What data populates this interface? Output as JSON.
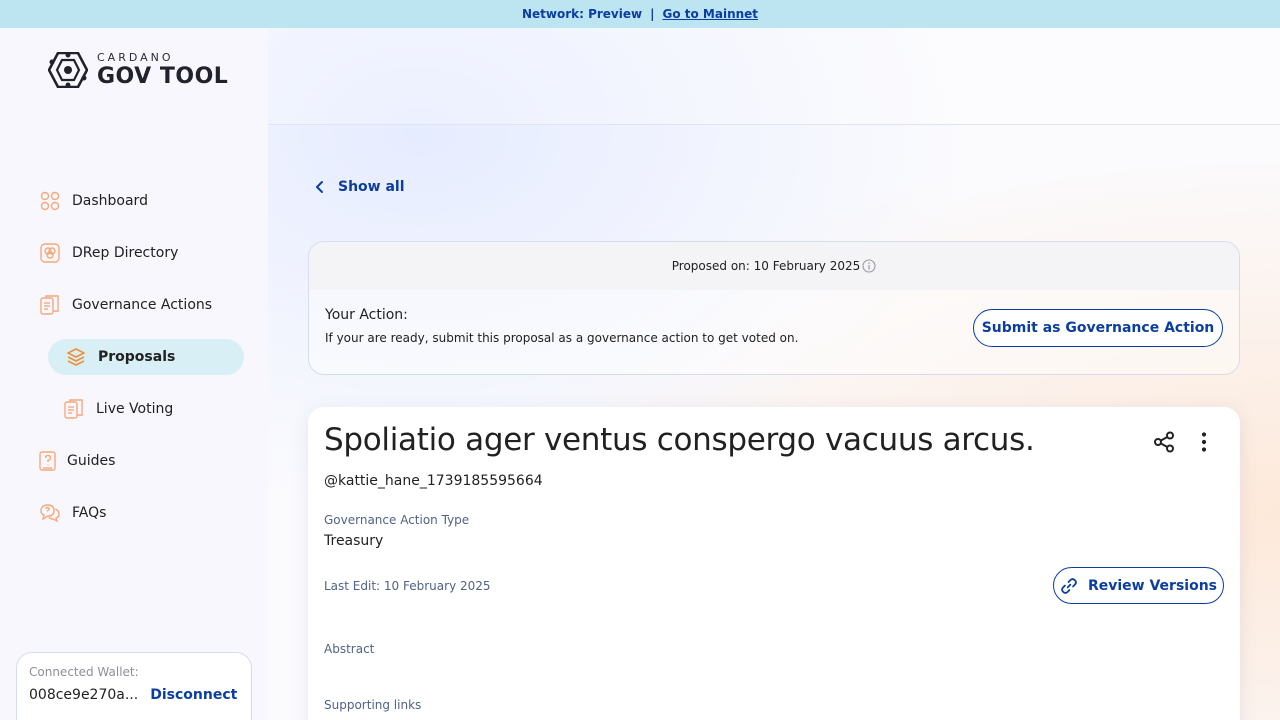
{
  "network_banner": {
    "label": "Network: Preview",
    "separator": "|",
    "link": "Go to Mainnet"
  },
  "logo": {
    "small_text": "CARDANO",
    "big_text": "GOV TOOL"
  },
  "sidebar": {
    "items": [
      {
        "label": "Dashboard",
        "icon": "dashboard-icon"
      },
      {
        "label": "DRep Directory",
        "icon": "drep-directory-icon"
      },
      {
        "label": "Governance Actions",
        "icon": "governance-actions-icon"
      },
      {
        "label": "Proposals",
        "icon": "proposals-icon",
        "active": true
      },
      {
        "label": "Live Voting",
        "icon": "live-voting-icon"
      },
      {
        "label": "Guides",
        "icon": "guides-icon"
      },
      {
        "label": "FAQs",
        "icon": "faqs-icon"
      }
    ],
    "active_color": "#d8eff6",
    "icon_color": "#f5a97a"
  },
  "wallet": {
    "label": "Connected Wallet:",
    "address": "008ce9e270a...",
    "disconnect": "Disconnect"
  },
  "show_all": "Show all",
  "action_card": {
    "proposed_on": "Proposed on: 10 February 2025",
    "your_action": "Your Action:",
    "description": "If your are ready, submit this proposal as a governance action to get voted on.",
    "submit_button": "Submit as Governance Action"
  },
  "proposal": {
    "title": "Spoliatio ager ventus conspergo vacuus arcus.",
    "username": "@kattie_hane_1739185595664",
    "type_label": "Governance Action Type",
    "type_value": "Treasury",
    "last_edit": "Last Edit: 10 February 2025",
    "review_button": "Review Versions",
    "abstract_label": "Abstract",
    "links_label": "Supporting links"
  },
  "colors": {
    "primary": "#0b3ea0",
    "banner_bg": "#bde4f1"
  }
}
